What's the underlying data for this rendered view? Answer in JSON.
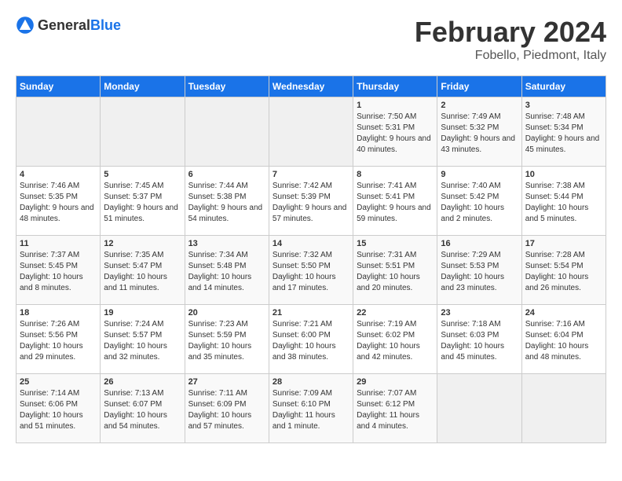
{
  "header": {
    "logo_general": "General",
    "logo_blue": "Blue",
    "main_title": "February 2024",
    "subtitle": "Fobello, Piedmont, Italy"
  },
  "columns": [
    "Sunday",
    "Monday",
    "Tuesday",
    "Wednesday",
    "Thursday",
    "Friday",
    "Saturday"
  ],
  "weeks": [
    [
      {
        "day": "",
        "empty": true
      },
      {
        "day": "",
        "empty": true
      },
      {
        "day": "",
        "empty": true
      },
      {
        "day": "",
        "empty": true
      },
      {
        "day": "1",
        "sunrise": "7:50 AM",
        "sunset": "5:31 PM",
        "daylight": "9 hours and 40 minutes."
      },
      {
        "day": "2",
        "sunrise": "7:49 AM",
        "sunset": "5:32 PM",
        "daylight": "9 hours and 43 minutes."
      },
      {
        "day": "3",
        "sunrise": "7:48 AM",
        "sunset": "5:34 PM",
        "daylight": "9 hours and 45 minutes."
      }
    ],
    [
      {
        "day": "4",
        "sunrise": "7:46 AM",
        "sunset": "5:35 PM",
        "daylight": "9 hours and 48 minutes."
      },
      {
        "day": "5",
        "sunrise": "7:45 AM",
        "sunset": "5:37 PM",
        "daylight": "9 hours and 51 minutes."
      },
      {
        "day": "6",
        "sunrise": "7:44 AM",
        "sunset": "5:38 PM",
        "daylight": "9 hours and 54 minutes."
      },
      {
        "day": "7",
        "sunrise": "7:42 AM",
        "sunset": "5:39 PM",
        "daylight": "9 hours and 57 minutes."
      },
      {
        "day": "8",
        "sunrise": "7:41 AM",
        "sunset": "5:41 PM",
        "daylight": "9 hours and 59 minutes."
      },
      {
        "day": "9",
        "sunrise": "7:40 AM",
        "sunset": "5:42 PM",
        "daylight": "10 hours and 2 minutes."
      },
      {
        "day": "10",
        "sunrise": "7:38 AM",
        "sunset": "5:44 PM",
        "daylight": "10 hours and 5 minutes."
      }
    ],
    [
      {
        "day": "11",
        "sunrise": "7:37 AM",
        "sunset": "5:45 PM",
        "daylight": "10 hours and 8 minutes."
      },
      {
        "day": "12",
        "sunrise": "7:35 AM",
        "sunset": "5:47 PM",
        "daylight": "10 hours and 11 minutes."
      },
      {
        "day": "13",
        "sunrise": "7:34 AM",
        "sunset": "5:48 PM",
        "daylight": "10 hours and 14 minutes."
      },
      {
        "day": "14",
        "sunrise": "7:32 AM",
        "sunset": "5:50 PM",
        "daylight": "10 hours and 17 minutes."
      },
      {
        "day": "15",
        "sunrise": "7:31 AM",
        "sunset": "5:51 PM",
        "daylight": "10 hours and 20 minutes."
      },
      {
        "day": "16",
        "sunrise": "7:29 AM",
        "sunset": "5:53 PM",
        "daylight": "10 hours and 23 minutes."
      },
      {
        "day": "17",
        "sunrise": "7:28 AM",
        "sunset": "5:54 PM",
        "daylight": "10 hours and 26 minutes."
      }
    ],
    [
      {
        "day": "18",
        "sunrise": "7:26 AM",
        "sunset": "5:56 PM",
        "daylight": "10 hours and 29 minutes."
      },
      {
        "day": "19",
        "sunrise": "7:24 AM",
        "sunset": "5:57 PM",
        "daylight": "10 hours and 32 minutes."
      },
      {
        "day": "20",
        "sunrise": "7:23 AM",
        "sunset": "5:59 PM",
        "daylight": "10 hours and 35 minutes."
      },
      {
        "day": "21",
        "sunrise": "7:21 AM",
        "sunset": "6:00 PM",
        "daylight": "10 hours and 38 minutes."
      },
      {
        "day": "22",
        "sunrise": "7:19 AM",
        "sunset": "6:02 PM",
        "daylight": "10 hours and 42 minutes."
      },
      {
        "day": "23",
        "sunrise": "7:18 AM",
        "sunset": "6:03 PM",
        "daylight": "10 hours and 45 minutes."
      },
      {
        "day": "24",
        "sunrise": "7:16 AM",
        "sunset": "6:04 PM",
        "daylight": "10 hours and 48 minutes."
      }
    ],
    [
      {
        "day": "25",
        "sunrise": "7:14 AM",
        "sunset": "6:06 PM",
        "daylight": "10 hours and 51 minutes."
      },
      {
        "day": "26",
        "sunrise": "7:13 AM",
        "sunset": "6:07 PM",
        "daylight": "10 hours and 54 minutes."
      },
      {
        "day": "27",
        "sunrise": "7:11 AM",
        "sunset": "6:09 PM",
        "daylight": "10 hours and 57 minutes."
      },
      {
        "day": "28",
        "sunrise": "7:09 AM",
        "sunset": "6:10 PM",
        "daylight": "11 hours and 1 minute."
      },
      {
        "day": "29",
        "sunrise": "7:07 AM",
        "sunset": "6:12 PM",
        "daylight": "11 hours and 4 minutes."
      },
      {
        "day": "",
        "empty": true
      },
      {
        "day": "",
        "empty": true
      }
    ]
  ]
}
